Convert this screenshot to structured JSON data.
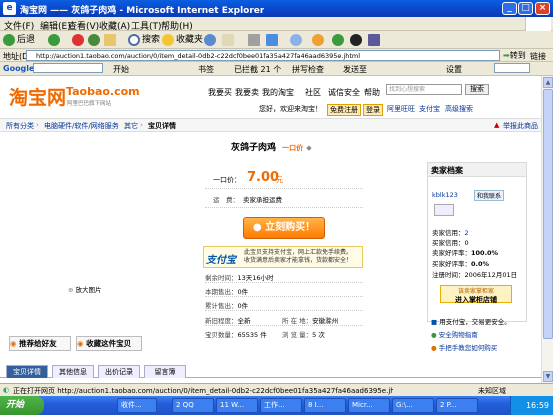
{
  "window": {
    "title": "淘宝网 —— 灰鸽子肉鸡 - Microsoft Internet Explorer"
  },
  "menu": [
    "文件(F)",
    "编辑(E)",
    "查看(V)",
    "收藏(A)",
    "工具(T)",
    "帮助(H)"
  ],
  "toolbar": {
    "back": "后退",
    "search": "搜索",
    "favorites": "收藏夹"
  },
  "address": {
    "label": "地址(D)",
    "url": "http://auction1.taobao.com/auction/0/item_detail-0db2-c22dcf0bee01fa35a427fa46aad6395e.jhtml",
    "go": "转到",
    "links": "链接"
  },
  "googlebar": {
    "brand": "Google",
    "start": "开始",
    "bookmarks": "书签",
    "blocked": "已拦截 21 个",
    "spell": "拼写检查",
    "send": "发送至",
    "settings": "设置"
  },
  "taobao": {
    "logo_cn": "淘宝网",
    "logo_en": "Taobao.com",
    "logo_sub": "阿里巴巴旗下网站",
    "nav": [
      "我要买",
      "我要卖",
      "我的淘宝",
      "社区",
      "诚信安全",
      "帮助"
    ],
    "search_placeholder": "找到心想搜索",
    "search_btn": "搜索",
    "welcome": "您好，欢迎来淘宝！",
    "register": "免费注册",
    "login": "登录",
    "wangwang": "阿里旺旺",
    "alipay": "支付宝",
    "advanced": "高级搜索"
  },
  "breadcrumb": [
    "所有分类",
    "电脑硬件/软件/网络服务",
    "其它",
    "宝贝详情"
  ],
  "report": "举报此商品",
  "item": {
    "title": "灰鸽子肉鸡",
    "price_type": "一口价",
    "price_label": "一口价：",
    "price": "7.00",
    "price_unit": "元",
    "shipping_label": "运　费：",
    "shipping_value": "卖家承担运费",
    "buy_btn": "立刻购买！",
    "alipay_logo": "支付宝",
    "alipay_text1": "此宝贝支持支付宝，网上汇款免手续费。",
    "alipay_text2": "收货满意后卖家才能拿钱，货款都安全！",
    "remaining_label": "剩余时间：",
    "remaining_value": "13天16小时",
    "sold_label": "本期售出：",
    "sold_value": "0件",
    "total_label": "累计售出：",
    "total_value": "0件",
    "condition_label": "新旧程度：",
    "condition_value": "全新",
    "location_label": "所 在 地：",
    "location_value": "安徽滁州",
    "qty_label": "宝贝数量：",
    "qty_value": "65535 件",
    "views_label": "浏 览 量：",
    "views_value": "5 次",
    "enlarge": "放大图片",
    "recommend": "推荐给好友",
    "favorite": "收藏这件宝贝"
  },
  "seller": {
    "header": "卖家档案",
    "name": "kblk123",
    "contact": "和我联系",
    "credit_label": "卖家信用：",
    "credit_value": "2",
    "buyer_credit_label": "买家信用：",
    "buyer_credit_value": "0",
    "good_label": "卖家好评率：",
    "good_value": "100.0%",
    "buyer_good_label": "买家好评率：",
    "buyer_good_value": "0.0%",
    "reg_label": "注册时间：",
    "reg_value": "2006年12月01日",
    "shop_btn1": "该卖家掌柜家",
    "shop_btn2": "进入掌柜店铺",
    "safe1": "用支付宝，交易更安全。",
    "safe2": "安全购物指南",
    "safe3": "手把手教您如何购买"
  },
  "tabs": [
    "宝贝详情",
    "其他信息",
    "出价记录",
    "留言簿"
  ],
  "status": {
    "text": "正在打开网页 http://auction1.taobao.com/auction/0/item_detail-0db2-c22dcf0bee01fa35a427fa46aad6395e.jhtml...",
    "zone": "未知区域"
  },
  "taskbar": {
    "start": "开始",
    "tasks": [
      "收件...",
      "2 QQ",
      "11 W...",
      "工作...",
      "8 I...",
      "Micr...",
      "G:\\...",
      "2 P..."
    ],
    "time": "16:59"
  }
}
